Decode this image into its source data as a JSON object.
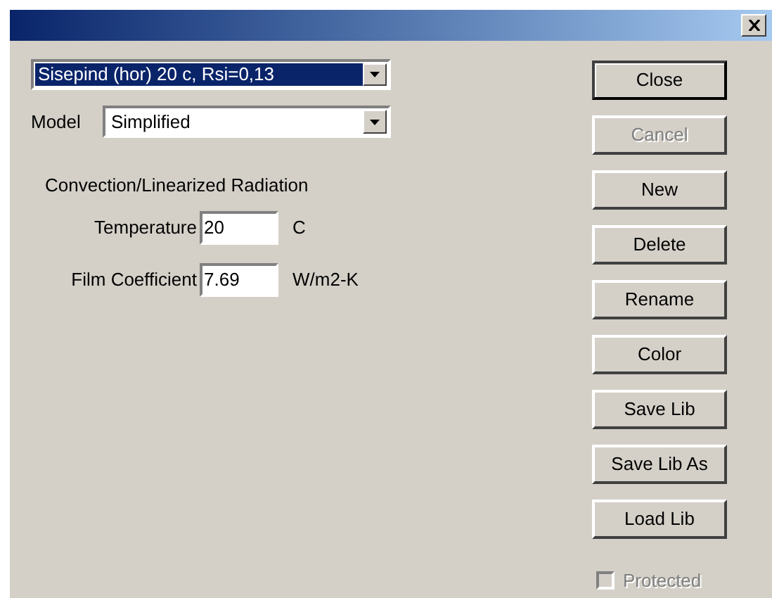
{
  "material": {
    "value": "Sisepind (hor) 20 c, Rsi=0,13",
    "highlighted": true
  },
  "model": {
    "label": "Model",
    "value": "Simplified"
  },
  "section_title": "Convection/Linearized Radiation",
  "fields": [
    {
      "label": "Temperature",
      "value": "20",
      "unit": "C"
    },
    {
      "label": "Film Coefficient",
      "value": "7.69",
      "unit": "W/m2-K"
    }
  ],
  "buttons": [
    {
      "label": "Close",
      "default": true,
      "disabled": false
    },
    {
      "label": "Cancel",
      "default": false,
      "disabled": true
    },
    {
      "label": "New",
      "default": false,
      "disabled": false
    },
    {
      "label": "Delete",
      "default": false,
      "disabled": false
    },
    {
      "label": "Rename",
      "default": false,
      "disabled": false
    },
    {
      "label": "Color",
      "default": false,
      "disabled": false
    },
    {
      "label": "Save Lib",
      "default": false,
      "disabled": false
    },
    {
      "label": "Save Lib As",
      "default": false,
      "disabled": false
    },
    {
      "label": "Load Lib",
      "default": false,
      "disabled": false
    }
  ],
  "protected": {
    "label": "Protected",
    "checked": false,
    "disabled": true
  }
}
